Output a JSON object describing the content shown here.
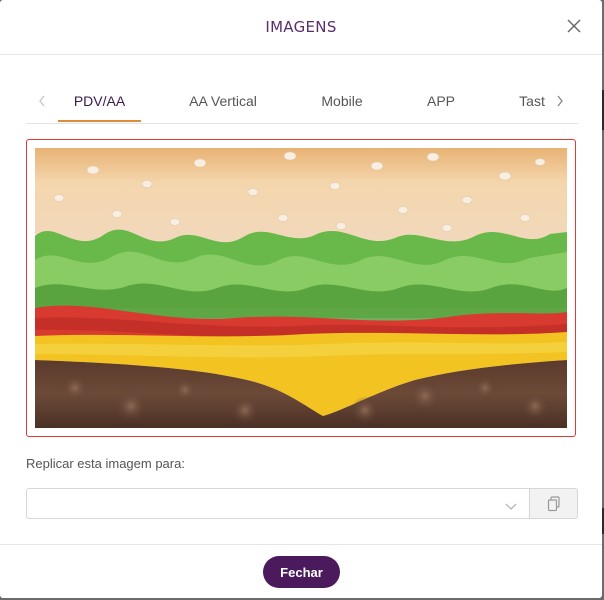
{
  "modal": {
    "title": "IMAGENS"
  },
  "tabs": [
    {
      "label": "PDV/AA",
      "active": true
    },
    {
      "label": "AA Vertical",
      "active": false
    },
    {
      "label": "Mobile",
      "active": false
    },
    {
      "label": "APP",
      "active": false
    },
    {
      "label": "Tast",
      "active": false
    }
  ],
  "replicate": {
    "label": "Replicar esta imagem para:",
    "selected_value": ""
  },
  "footer": {
    "close_label": "Fechar"
  },
  "colors": {
    "title": "#5a2d6e",
    "active_tab_underline": "#e08a3c",
    "image_border": "#e53935",
    "primary_button": "#4a1a5c"
  },
  "icons": [
    "close-icon",
    "chevron-left-icon",
    "chevron-right-icon",
    "chevron-down-icon",
    "copy-icon"
  ]
}
